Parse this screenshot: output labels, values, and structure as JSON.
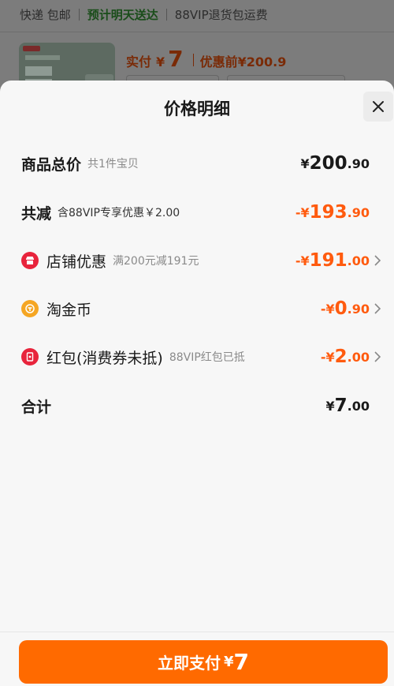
{
  "background": {
    "shipping": {
      "express": "快递 包邮",
      "eta": "预计明天送达",
      "return": "88VIP退货包运费"
    },
    "price": {
      "paid_label": "实付",
      "currency": "¥",
      "paid_value": "7",
      "before_label": "优惠前¥200.9"
    }
  },
  "sheet": {
    "title": "价格明细",
    "close_icon": "close-icon"
  },
  "rows": {
    "total": {
      "label": "商品总价",
      "sub": "共1件宝贝",
      "currency": "¥",
      "int": "200",
      "dec": ".90"
    },
    "reduced": {
      "label": "共减",
      "sub": "含88VIP专享优惠￥2.00",
      "prefix": "-¥",
      "int": "193",
      "dec": ".90"
    },
    "store": {
      "icon": "store-icon",
      "label": "店铺优惠",
      "sub": "满200元减191元",
      "prefix": "-¥",
      "int": "191",
      "dec": ".00"
    },
    "coin": {
      "icon": "coin-icon",
      "label": "淘金币",
      "sub": "",
      "prefix": "-¥",
      "int": "0",
      "dec": ".90"
    },
    "redpacket": {
      "icon": "red-packet-icon",
      "label": "红包(消费券未抵)",
      "sub": "88VIP红包已抵",
      "prefix": "-¥",
      "int": "2",
      "dec": ".00"
    },
    "sum": {
      "label": "合计",
      "currency": "¥",
      "int": "7",
      "dec": ".00"
    }
  },
  "footer": {
    "pay_label": "立即支付",
    "currency": "¥",
    "value": "7"
  },
  "colors": {
    "accent": "#ff6a00",
    "discount": "#ff5b0f",
    "store_icon": "#e8243c",
    "coin_icon": "#f5a623",
    "red_packet_icon": "#e8243c"
  }
}
